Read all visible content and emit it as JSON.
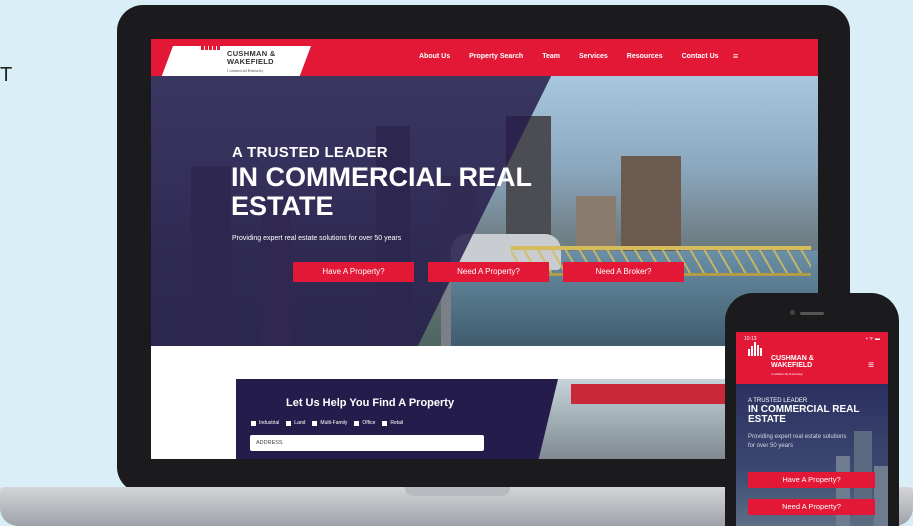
{
  "edge_text": "T",
  "site": {
    "logo": {
      "line1": "CUSHMAN &",
      "line2": "WAKEFIELD",
      "sub": "Commercial Kentucky"
    },
    "nav": {
      "items": [
        "About Us",
        "Property Search",
        "Team",
        "Services",
        "Resources",
        "Contact Us"
      ],
      "menu_icon": "≡"
    },
    "hero": {
      "heading_small": "A TRUSTED LEADER",
      "heading_large": "IN COMMERCIAL REAL ESTATE",
      "subtitle": "Providing expert real estate solutions for over 50 years",
      "buttons": [
        "Have A Property?",
        "Need A Property?",
        "Need A Broker?"
      ]
    },
    "search": {
      "title": "Let Us Help You Find A Property",
      "types": [
        "Industrial",
        "Land",
        "Multi-Family",
        "Office",
        "Retail"
      ],
      "address_placeholder": "ADDRESS"
    }
  },
  "phone": {
    "time": "10:13",
    "status_icons": "▪ ᯤ ▬",
    "logo": {
      "line1": "CUSHMAN &",
      "line2": "WAKEFIELD",
      "sub": "Commercial Kentucky"
    },
    "menu_icon": "≡",
    "hero": {
      "heading_small": "A TRUSTED LEADER",
      "heading_large": "IN COMMERCIAL REAL ESTATE",
      "subtitle": "Providing expert real estate solutions for over 50 years",
      "buttons": [
        "Have A Property?",
        "Need A Property?"
      ]
    }
  },
  "colors": {
    "brand_red": "#e31837",
    "navy": "#241d4c",
    "background": "#d9eef7"
  }
}
